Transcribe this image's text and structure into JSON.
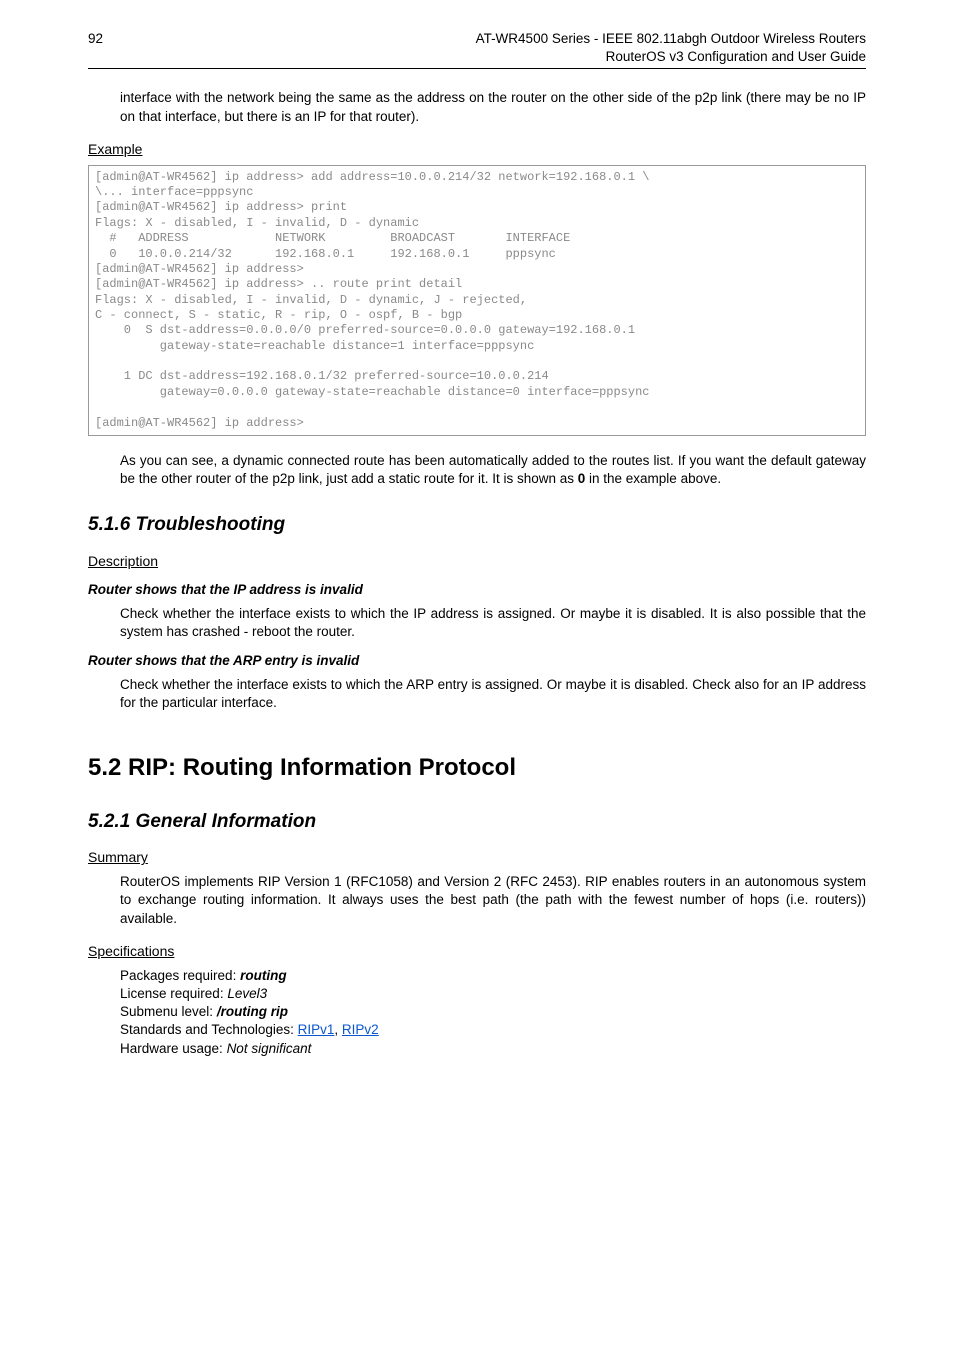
{
  "header": {
    "page_number": "92",
    "title_line1": "AT-WR4500 Series - IEEE 802.11abgh Outdoor Wireless Routers",
    "title_line2": "RouterOS v3 Configuration and User Guide"
  },
  "intro_para": "interface with the network being the same as the address on the router on the other side of the p2p link (there may be no IP on that interface, but there is an IP for that router).",
  "example_heading": "Example",
  "code": "[admin@AT-WR4562] ip address> add address=10.0.0.214/32 network=192.168.0.1 \\\n\\... interface=pppsync\n[admin@AT-WR4562] ip address> print\nFlags: X - disabled, I - invalid, D - dynamic\n  #   ADDRESS            NETWORK         BROADCAST       INTERFACE\n  0   10.0.0.214/32      192.168.0.1     192.168.0.1     pppsync\n[admin@AT-WR4562] ip address>\n[admin@AT-WR4562] ip address> .. route print detail\nFlags: X - disabled, I - invalid, D - dynamic, J - rejected,\nC - connect, S - static, R - rip, O - ospf, B - bgp\n    0  S dst-address=0.0.0.0/0 preferred-source=0.0.0.0 gateway=192.168.0.1\n         gateway-state=reachable distance=1 interface=pppsync\n\n    1 DC dst-address=192.168.0.1/32 preferred-source=10.0.0.214\n         gateway=0.0.0.0 gateway-state=reachable distance=0 interface=pppsync\n\n[admin@AT-WR4562] ip address>",
  "after_code_1": "As you can see, a dynamic connected route has been automatically added to the routes list. If you want the default gateway be the other router of the p2p link, just add a static route for it. It is shown as ",
  "after_code_bold": "0",
  "after_code_2": " in the example above.",
  "s516_title": "5.1.6  Troubleshooting",
  "s516_desc_heading": "Description",
  "s516_ip_heading": "Router shows that the IP address is invalid",
  "s516_ip_body": "Check whether the interface exists to which the IP address is assigned. Or maybe it is disabled. It is also possible that the system has crashed - reboot the router.",
  "s516_arp_heading": "Router shows that the ARP entry is invalid",
  "s516_arp_body": "Check whether the interface exists to which the ARP entry is assigned. Or maybe it is disabled. Check also for an IP address for the particular interface.",
  "s52_title": "5.2  RIP: Routing Information Protocol",
  "s521_title": "5.2.1  General Information",
  "s521_summary_heading": "Summary",
  "s521_summary_body": " RouterOS implements RIP Version 1 (RFC1058) and Version 2 (RFC 2453). RIP enables routers in an autonomous system to exchange routing information. It always uses the best path (the path with the fewest number of hops (i.e. routers)) available.",
  "s521_spec_heading": "Specifications",
  "specs": {
    "packages_label": "Packages required: ",
    "packages_val": "routing",
    "license_label": "License required: ",
    "license_val": "Level3",
    "submenu_label": "Submenu level: ",
    "submenu_val": "/routing rip",
    "std_label": "Standards and Technologies: ",
    "ripv1": "RIPv1",
    "sep": ", ",
    "ripv2": "RIPv2",
    "hw_label": "Hardware usage: ",
    "hw_val": "Not significant"
  }
}
